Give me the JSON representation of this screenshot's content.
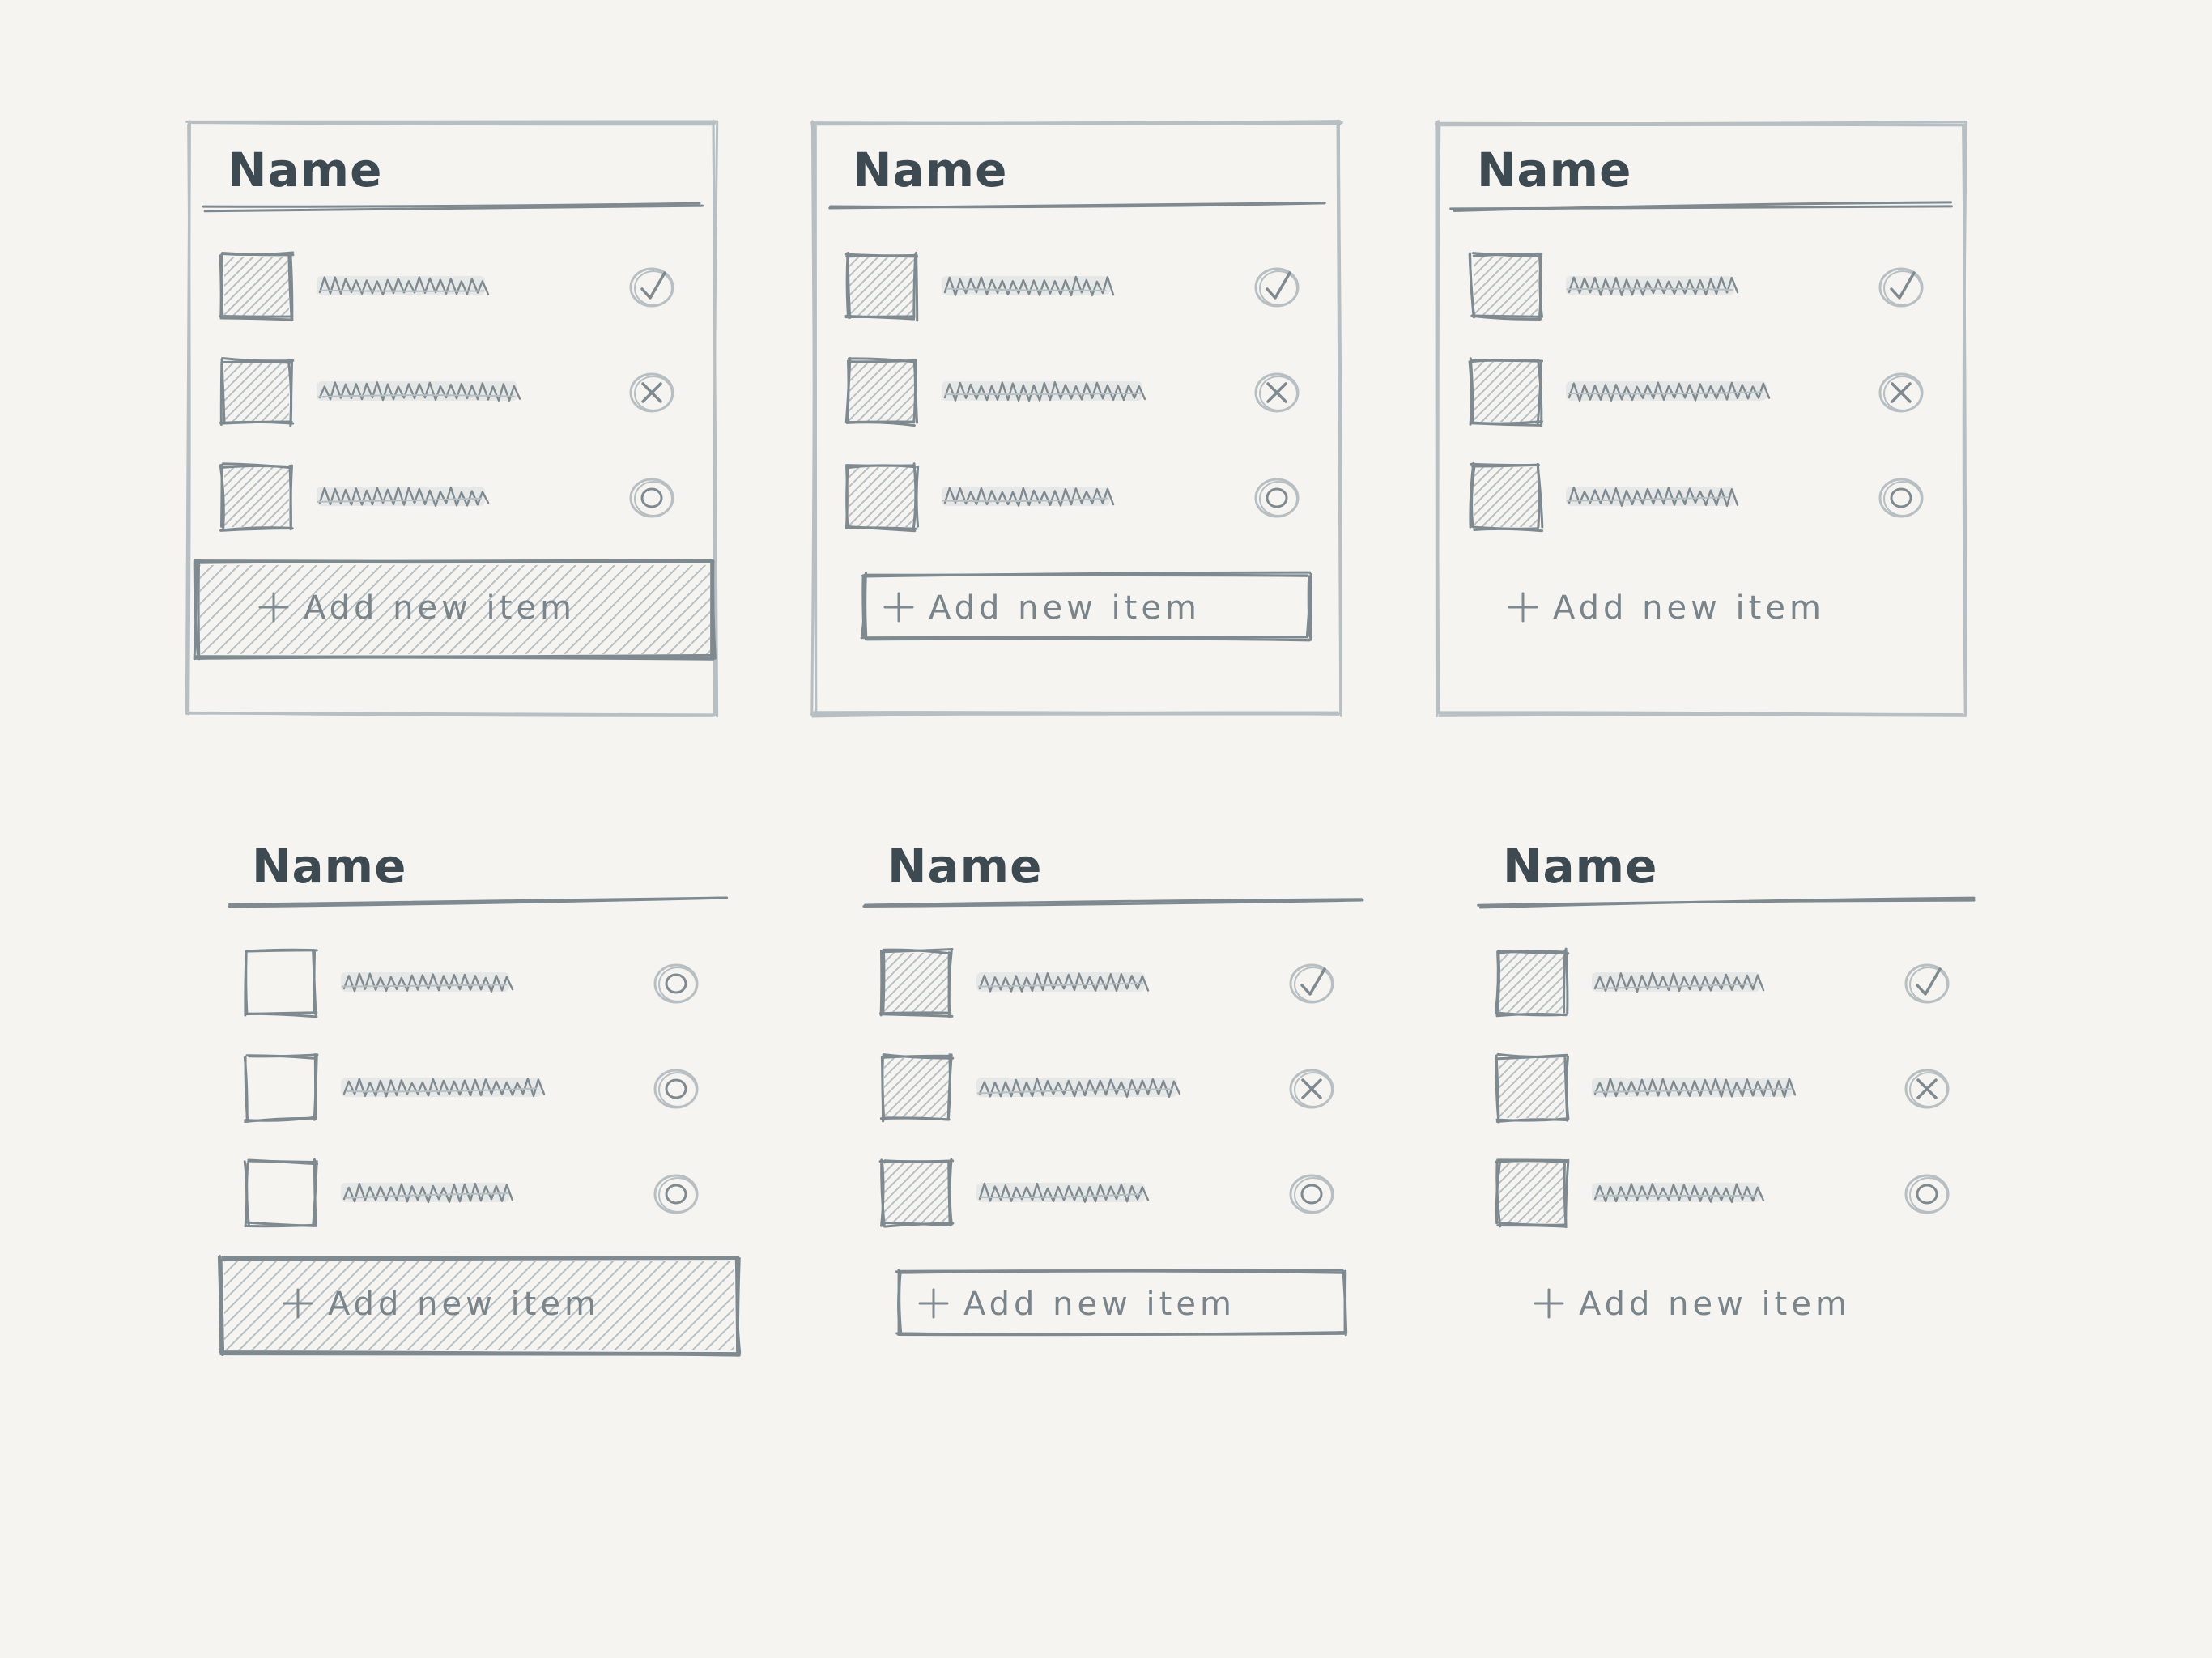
{
  "sketch": {
    "palette": {
      "paper": "#f5f4f0",
      "ink": "#7f8a90",
      "ink_soft": "#b7bfc3",
      "heading": "#3e4a52"
    },
    "cards": [
      {
        "title": "Name",
        "framed": true,
        "add_button_style": "filled-bar",
        "add_label": "+ Add new item",
        "rows": [
          {
            "checkbox": "filled",
            "status_icon": "check-icon"
          },
          {
            "checkbox": "filled",
            "status_icon": "x-icon"
          },
          {
            "checkbox": "filled",
            "status_icon": "circle-icon"
          }
        ]
      },
      {
        "title": "Name",
        "framed": true,
        "add_button_style": "outlined-button",
        "add_label": "+ Add new item",
        "rows": [
          {
            "checkbox": "filled",
            "status_icon": "check-icon"
          },
          {
            "checkbox": "filled",
            "status_icon": "x-icon"
          },
          {
            "checkbox": "filled",
            "status_icon": "circle-icon"
          }
        ]
      },
      {
        "title": "Name",
        "framed": true,
        "add_button_style": "text-link",
        "add_label": "+ Add new item",
        "rows": [
          {
            "checkbox": "filled",
            "status_icon": "check-icon"
          },
          {
            "checkbox": "filled",
            "status_icon": "x-icon"
          },
          {
            "checkbox": "filled",
            "status_icon": "circle-icon"
          }
        ]
      },
      {
        "title": "Name",
        "framed": false,
        "add_button_style": "filled-bar",
        "add_label": "+ Add new item",
        "rows": [
          {
            "checkbox": "empty",
            "status_icon": "circle-icon"
          },
          {
            "checkbox": "empty",
            "status_icon": "circle-icon"
          },
          {
            "checkbox": "empty",
            "status_icon": "circle-icon"
          }
        ]
      },
      {
        "title": "Name",
        "framed": false,
        "add_button_style": "outlined-button",
        "add_label": "+ Add new item",
        "rows": [
          {
            "checkbox": "filled",
            "status_icon": "check-icon"
          },
          {
            "checkbox": "filled",
            "status_icon": "x-icon"
          },
          {
            "checkbox": "filled",
            "status_icon": "circle-icon"
          }
        ]
      },
      {
        "title": "Name",
        "framed": false,
        "add_button_style": "text-link",
        "add_label": "+ Add new item",
        "rows": [
          {
            "checkbox": "filled",
            "status_icon": "check-icon"
          },
          {
            "checkbox": "filled",
            "status_icon": "x-icon"
          },
          {
            "checkbox": "filled",
            "status_icon": "circle-icon"
          }
        ]
      }
    ]
  }
}
